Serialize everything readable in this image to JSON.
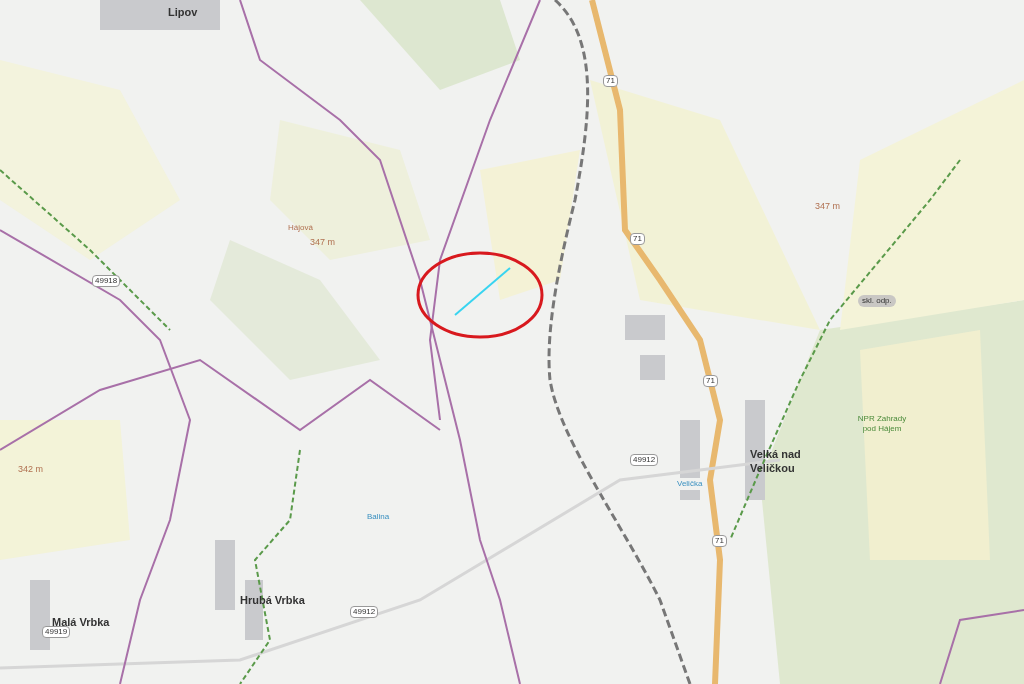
{
  "map": {
    "places": [
      {
        "kind": "village",
        "label": "Lipov"
      },
      {
        "kind": "village",
        "label": "Hrubá Vrbka"
      },
      {
        "kind": "village",
        "label": "Malá Vrbka"
      },
      {
        "kind": "town",
        "label": "Velká nad Veličkou"
      },
      {
        "kind": "locality",
        "label": "Hájová"
      },
      {
        "kind": "elevation",
        "label": "347 m"
      },
      {
        "kind": "elevation",
        "label": "347 m"
      },
      {
        "kind": "elevation",
        "label": "342 m"
      },
      {
        "kind": "feature",
        "label": "skl. odp."
      },
      {
        "kind": "reserve",
        "label": "NPR Zahrady pod Hájem"
      },
      {
        "kind": "stream",
        "label": "Balina"
      },
      {
        "kind": "stream",
        "label": "Velička"
      }
    ],
    "road_numbers": [
      "49918",
      "71",
      "71",
      "71",
      "71",
      "49912",
      "49912",
      "49919"
    ]
  }
}
